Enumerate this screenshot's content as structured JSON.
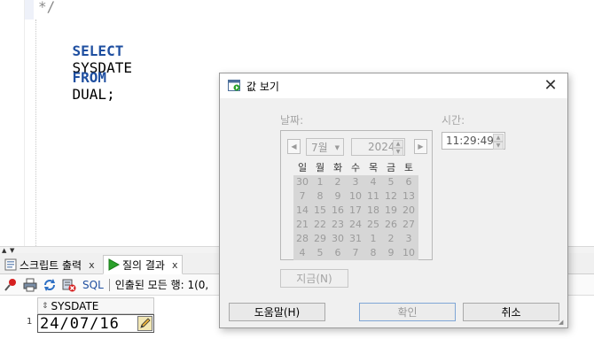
{
  "editor": {
    "lines": [
      "*/",
      "SELECT",
      "SYSDATE",
      "FROM",
      "DUAL;"
    ]
  },
  "bottom_panel": {
    "tabs": [
      {
        "label": "스크립트 출력",
        "close": "x"
      },
      {
        "label": "질의 결과",
        "close": "x"
      }
    ],
    "toolbar": {
      "sql_label": "SQL",
      "status": "인출된 모든 행: 1(0,"
    },
    "grid": {
      "column": "SYSDATE",
      "row_number": "1",
      "value": "24/07/16"
    }
  },
  "dialog": {
    "title": "값 보기",
    "close": "✕",
    "date_label": "날짜:",
    "time_label": "시간:",
    "month": "7월",
    "year": "2024",
    "time": "11:29:49",
    "weekdays": [
      "일",
      "월",
      "화",
      "수",
      "목",
      "금",
      "토"
    ],
    "weeks": [
      [
        "30",
        "1",
        "2",
        "3",
        "4",
        "5",
        "6"
      ],
      [
        "7",
        "8",
        "9",
        "10",
        "11",
        "12",
        "13"
      ],
      [
        "14",
        "15",
        "16",
        "17",
        "18",
        "19",
        "20"
      ],
      [
        "21",
        "22",
        "23",
        "24",
        "25",
        "26",
        "27"
      ],
      [
        "28",
        "29",
        "30",
        "31",
        "1",
        "2",
        "3"
      ],
      [
        "4",
        "5",
        "6",
        "7",
        "8",
        "9",
        "10"
      ]
    ],
    "now_button": "지금(N)",
    "help_button": "도움말(H)",
    "ok_button": "확인",
    "cancel_button": "취소"
  }
}
